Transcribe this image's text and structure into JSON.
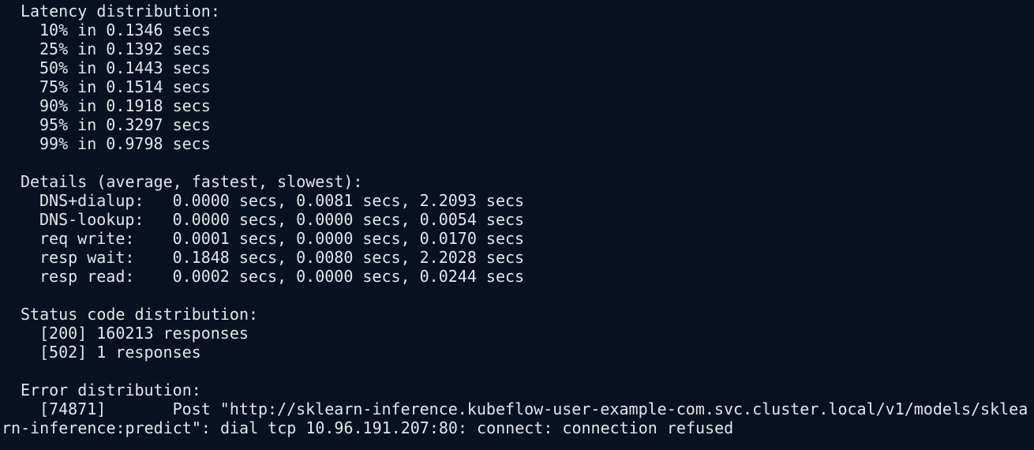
{
  "terminal": {
    "latency": {
      "title": "Latency distribution:",
      "rows": [
        "10% in 0.1346 secs",
        "25% in 0.1392 secs",
        "50% in 0.1443 secs",
        "75% in 0.1514 secs",
        "90% in 0.1918 secs",
        "95% in 0.3297 secs",
        "99% in 0.9798 secs"
      ]
    },
    "details": {
      "title": "Details (average, fastest, slowest):",
      "rows": [
        "DNS+dialup:   0.0000 secs, 0.0081 secs, 2.2093 secs",
        "DNS-lookup:   0.0000 secs, 0.0000 secs, 0.0054 secs",
        "req write:    0.0001 secs, 0.0000 secs, 0.0170 secs",
        "resp wait:    0.1848 secs, 0.0080 secs, 2.2028 secs",
        "resp read:    0.0002 secs, 0.0000 secs, 0.0244 secs"
      ]
    },
    "status": {
      "title": "Status code distribution:",
      "rows": [
        "[200] 160213 responses",
        "[502] 1 responses"
      ]
    },
    "errors": {
      "title": "Error distribution:",
      "line1": "[74871]       Post \"http://sklearn-inference.kubeflow-user-example-com.svc.cluster.local/v1/models/sklea",
      "line2": "rn-inference:predict\": dial tcp 10.96.191.207:80: connect: connection refused"
    }
  }
}
